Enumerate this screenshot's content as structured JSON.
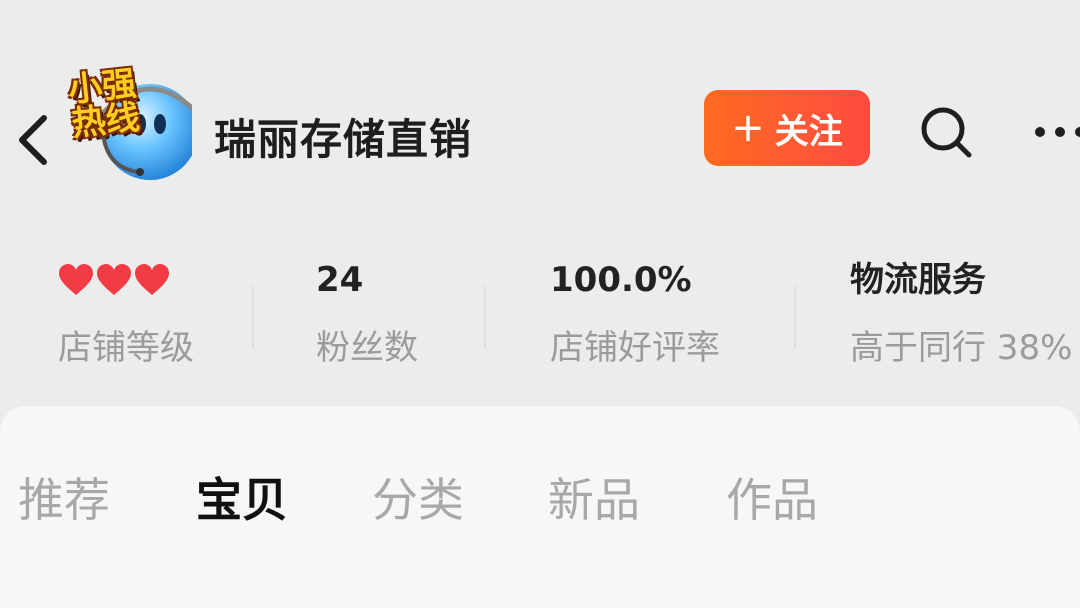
{
  "header": {
    "avatar_badge_text": "小强\n热线",
    "shop_name": "瑞丽存储直销",
    "follow_label": "关注"
  },
  "stats": [
    {
      "value": "",
      "label": "店铺等级",
      "hearts": 3
    },
    {
      "value": "24",
      "label": "粉丝数"
    },
    {
      "value": "100.0%",
      "label": "店铺好评率"
    },
    {
      "value": "物流服务",
      "label": "高于同行 38%"
    }
  ],
  "tabs": [
    {
      "label": "推荐",
      "active": false
    },
    {
      "label": "宝贝",
      "active": true
    },
    {
      "label": "分类",
      "active": false
    },
    {
      "label": "新品",
      "active": false
    },
    {
      "label": "作品",
      "active": false
    }
  ],
  "colors": {
    "follow_gradient_start": "#ff6a1f",
    "follow_gradient_end": "#ff4b3f",
    "heart": "#f23b45",
    "tab_active": "#111111",
    "tab_inactive": "#a8a8a8"
  }
}
